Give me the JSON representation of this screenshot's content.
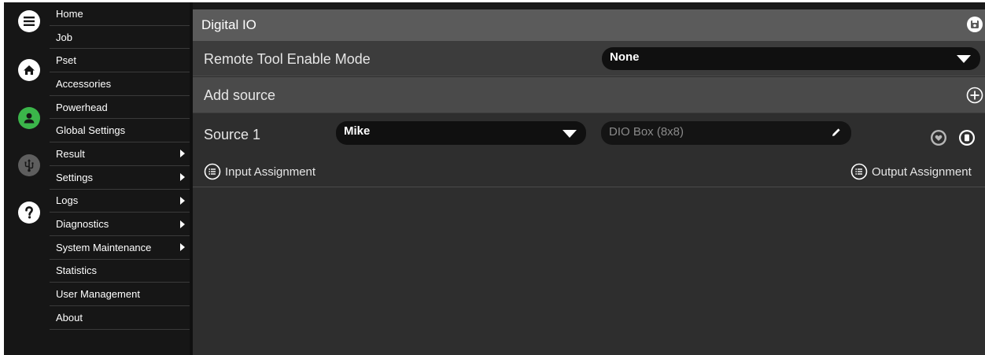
{
  "rail": {
    "icons": [
      "menu-icon",
      "home-icon",
      "user-icon",
      "usb-icon",
      "help-icon"
    ],
    "user_color": "#3bb54a"
  },
  "sidebar": {
    "items": [
      {
        "label": "Home",
        "submenu": false
      },
      {
        "label": "Job",
        "submenu": false
      },
      {
        "label": "Pset",
        "submenu": false
      },
      {
        "label": "Accessories",
        "submenu": false
      },
      {
        "label": "Powerhead",
        "submenu": false
      },
      {
        "label": "Global Settings",
        "submenu": false
      },
      {
        "label": "Result",
        "submenu": true
      },
      {
        "label": "Settings",
        "submenu": true
      },
      {
        "label": "Logs",
        "submenu": true
      },
      {
        "label": "Diagnostics",
        "submenu": true
      },
      {
        "label": "System Maintenance",
        "submenu": true
      },
      {
        "label": "Statistics",
        "submenu": false
      },
      {
        "label": "User Management",
        "submenu": false
      },
      {
        "label": "About",
        "submenu": false
      }
    ]
  },
  "main": {
    "title": "Digital IO",
    "remote_tool": {
      "label": "Remote Tool Enable Mode",
      "value": "None"
    },
    "add_source": {
      "label": "Add source"
    },
    "source1": {
      "label": "Source 1",
      "name_value": "Mike",
      "device_value": "DIO Box (8x8)"
    },
    "input_assignment": "Input Assignment",
    "output_assignment": "Output Assignment"
  }
}
